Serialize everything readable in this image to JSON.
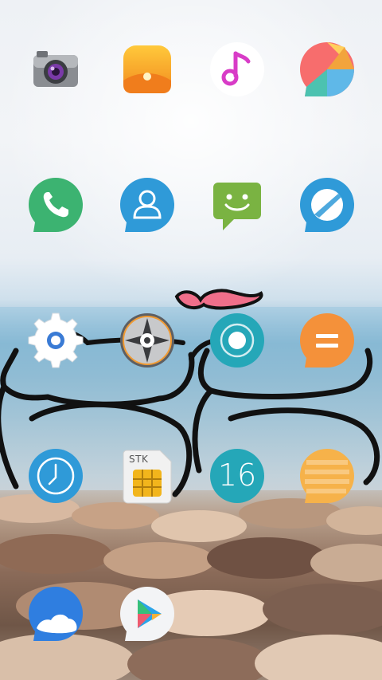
{
  "home": {
    "apps": [
      {
        "id": "camera",
        "icon": "camera-icon"
      },
      {
        "id": "gallery",
        "icon": "gallery-icon"
      },
      {
        "id": "music",
        "icon": "music-note-icon"
      },
      {
        "id": "themes",
        "icon": "themes-icon"
      },
      {
        "id": "phone",
        "icon": "phone-icon"
      },
      {
        "id": "contacts",
        "icon": "contacts-icon"
      },
      {
        "id": "messaging",
        "icon": "smiley-message-icon"
      },
      {
        "id": "browser",
        "icon": "compass-browser-icon"
      },
      {
        "id": "settings",
        "icon": "gear-icon"
      },
      {
        "id": "compass",
        "icon": "compass-icon"
      },
      {
        "id": "recorder",
        "icon": "record-icon"
      },
      {
        "id": "calculator",
        "icon": "calculator-icon"
      },
      {
        "id": "clock",
        "icon": "clock-icon"
      },
      {
        "id": "sim-toolkit",
        "icon": "sim-card-icon",
        "label": "STK"
      },
      {
        "id": "calendar",
        "icon": "calendar-icon",
        "date": "16"
      },
      {
        "id": "notes",
        "icon": "notes-icon"
      },
      {
        "id": "weather",
        "icon": "weather-icon"
      },
      {
        "id": "play-store",
        "icon": "play-store-icon"
      }
    ]
  },
  "colors": {
    "green": "#3cb371",
    "blue": "#2f9ad8",
    "teal": "#25a7b8",
    "orange": "#f4913a",
    "heart": "#f06f8a"
  }
}
